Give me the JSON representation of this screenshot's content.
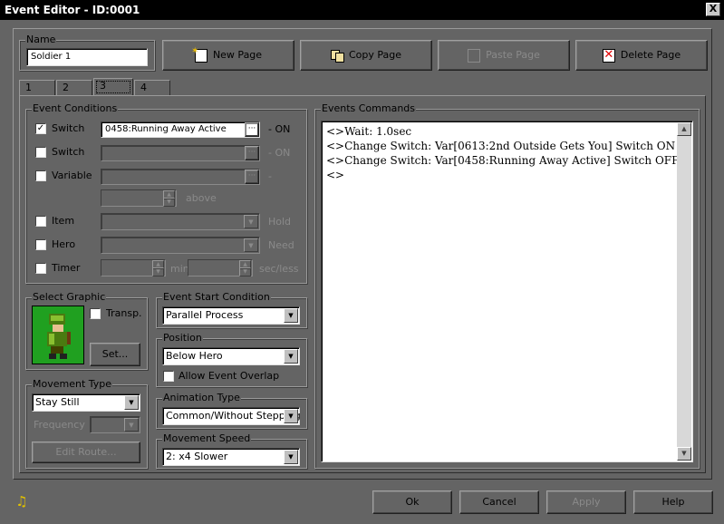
{
  "window": {
    "title": "Event Editor - ID:0001",
    "close_glyph": "X"
  },
  "name_group": {
    "label": "Name",
    "value": "Soldier 1"
  },
  "toolbar": {
    "new_page": "New Page",
    "copy_page": "Copy Page",
    "paste_page": "Paste Page",
    "delete_page": "Delete Page"
  },
  "tabs": [
    "1",
    "2",
    "3",
    "4"
  ],
  "active_tab": "3",
  "conditions": {
    "label": "Event Conditions",
    "switch1": {
      "label": "Switch",
      "checked": true,
      "value": "0458:Running Away Active",
      "browse": "···",
      "suffix": "- ON"
    },
    "switch2": {
      "label": "Switch",
      "value": "",
      "browse": "···",
      "suffix": "- ON"
    },
    "variable": {
      "label": "Variable",
      "value": "",
      "browse": "···",
      "suffix": "-"
    },
    "above": "above",
    "item": {
      "label": "Item",
      "suffix": "Hold"
    },
    "hero": {
      "label": "Hero",
      "suffix": "Need"
    },
    "timer": {
      "label": "Timer",
      "min": "min",
      "sec": "sec/less"
    }
  },
  "graphic": {
    "label": "Select Graphic",
    "transp": "Transp.",
    "set": "Set..."
  },
  "movement": {
    "label": "Movement Type",
    "value": "Stay Still",
    "frequency": "Frequency",
    "edit_route": "Edit Route..."
  },
  "start_condition": {
    "label": "Event Start Condition",
    "value": "Parallel Process"
  },
  "position": {
    "label": "Position",
    "value": "Below Hero",
    "overlap": "Allow Event Overlap"
  },
  "animation": {
    "label": "Animation Type",
    "value": "Common/Without Stepping"
  },
  "speed": {
    "label": "Movement Speed",
    "value": "2: x4 Slower"
  },
  "commands": {
    "label": "Events Commands",
    "lines": [
      "<>Wait: 1.0sec",
      "<>Change Switch: Var[0613:2nd Outside Gets You] Switch ON",
      "<>Change Switch: Var[0458:Running Away Active] Switch OFF",
      "<>"
    ]
  },
  "footer": {
    "ok": "Ok",
    "cancel": "Cancel",
    "apply": "Apply",
    "help": "Help"
  },
  "icons": {
    "music": "music-note-icon"
  }
}
